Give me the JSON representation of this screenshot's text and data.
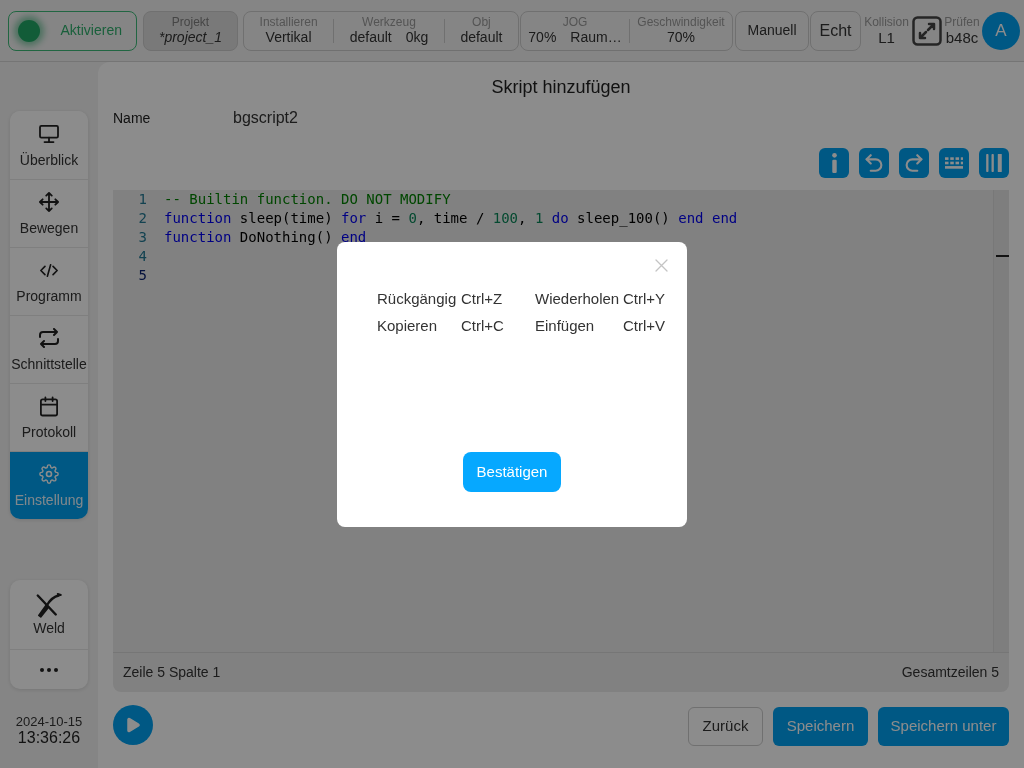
{
  "top_bar": {
    "activate_button": {
      "label": "Aktivieren"
    },
    "project": {
      "label": "Projekt",
      "value": "*project_1"
    },
    "status_groups": [
      [
        {
          "label": "Installieren",
          "values": [
            "Vertikal"
          ]
        },
        {
          "label": "Werkzeug",
          "values": [
            "default",
            "0kg"
          ]
        },
        {
          "label": "Obj",
          "values": [
            "default"
          ]
        }
      ],
      [
        {
          "label": "JOG",
          "values": [
            "70%",
            "Raum…"
          ]
        },
        {
          "label": "Geschwindigkeit",
          "values": [
            "70%"
          ]
        }
      ]
    ],
    "mode_buttons": [
      "Manuell",
      "Echt"
    ],
    "collision": {
      "label": "Kollision",
      "value": "L1"
    },
    "check": {
      "label": "Prüfen",
      "value": "b48c"
    },
    "avatar": "A"
  },
  "sidebar": {
    "items": [
      {
        "label": "Überblick",
        "selected": false
      },
      {
        "label": "Bewegen",
        "selected": false
      },
      {
        "label": "Programm",
        "selected": false
      },
      {
        "label": "Schnittstelle",
        "selected": false
      },
      {
        "label": "Protokoll",
        "selected": false
      },
      {
        "label": "Einstellung",
        "selected": true
      }
    ],
    "extra_items": [
      {
        "kind": "weld",
        "label": "Weld"
      },
      {
        "kind": "more"
      }
    ],
    "date": "2024-10-15",
    "time": "13:36:26"
  },
  "script_editor": {
    "title": "Skript hinzufügen",
    "name_label": "Name",
    "name_value": "bgscript2",
    "code_lines": [
      {
        "number": "1",
        "current": false,
        "tokens": [
          {
            "kind": "comment",
            "text": "-- Builtin function. DO NOT MODIFY"
          }
        ]
      },
      {
        "number": "2",
        "current": false,
        "tokens": [
          {
            "kind": "keyword",
            "text": "function"
          },
          {
            "kind": "plain",
            "text": " sleep(time) "
          },
          {
            "kind": "keyword",
            "text": "for"
          },
          {
            "kind": "plain",
            "text": " i = "
          },
          {
            "kind": "number",
            "text": "0"
          },
          {
            "kind": "plain",
            "text": ", time / "
          },
          {
            "kind": "number",
            "text": "100"
          },
          {
            "kind": "plain",
            "text": ", "
          },
          {
            "kind": "number",
            "text": "1"
          },
          {
            "kind": "keyword",
            "text": " do"
          },
          {
            "kind": "plain",
            "text": " sleep_100() "
          },
          {
            "kind": "keyword",
            "text": "end"
          },
          {
            "kind": "keyword",
            "text": " end"
          }
        ]
      },
      {
        "number": "3",
        "current": false,
        "tokens": [
          {
            "kind": "keyword",
            "text": "function"
          },
          {
            "kind": "plain",
            "text": " DoNothing() "
          },
          {
            "kind": "keyword",
            "text": "end"
          }
        ]
      },
      {
        "number": "4",
        "current": false
      },
      {
        "number": "5",
        "current": true
      }
    ],
    "status_left": "Zeile 5 Spalte 1",
    "status_right": "Gesamtzeilen 5",
    "buttons": [
      {
        "label": "Zurück",
        "kind": "secondary"
      },
      {
        "label": "Speichern",
        "kind": "primary"
      },
      {
        "label": "Speichern unter",
        "kind": "primary"
      }
    ]
  },
  "shortcut_dialog": {
    "shortcuts": [
      {
        "action": "Rückgängig",
        "keys": "Ctrl+Z"
      },
      {
        "action": "Wiederholen",
        "keys": "Ctrl+Y"
      },
      {
        "action": "Kopieren",
        "keys": "Ctrl+C"
      },
      {
        "action": "Einfügen",
        "keys": "Ctrl+V"
      }
    ],
    "confirm_button": "Bestätigen"
  }
}
